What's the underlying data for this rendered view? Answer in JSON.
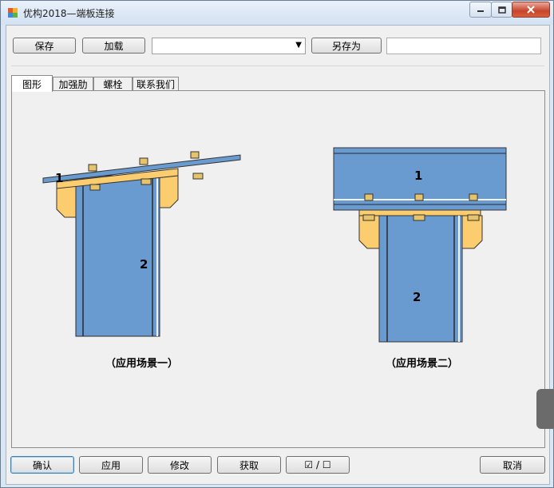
{
  "window": {
    "title": "优构2018—端板连接"
  },
  "toolbar": {
    "save_label": "保存",
    "load_label": "加载",
    "combo_value": "",
    "save_as_label": "另存为",
    "save_as_value": ""
  },
  "tabs": [
    {
      "label": "图形",
      "active": true
    },
    {
      "label": "加强肋",
      "active": false
    },
    {
      "label": "螺栓",
      "active": false
    },
    {
      "label": "联系我们",
      "active": false
    }
  ],
  "figures": {
    "scene1": {
      "caption": "（应用场景一）",
      "label_beam": "1",
      "label_column": "2"
    },
    "scene2": {
      "caption": "（应用场景二）",
      "label_beam": "1",
      "label_column": "2"
    }
  },
  "bottom": {
    "confirm_label": "确认",
    "apply_label": "应用",
    "modify_label": "修改",
    "fetch_label": "获取",
    "toggle_label": "☑ / ☐",
    "cancel_label": "取消"
  },
  "colors": {
    "steel": "#6a9bd0",
    "plate": "#fccd6e",
    "bolt": "#e7c46b"
  }
}
